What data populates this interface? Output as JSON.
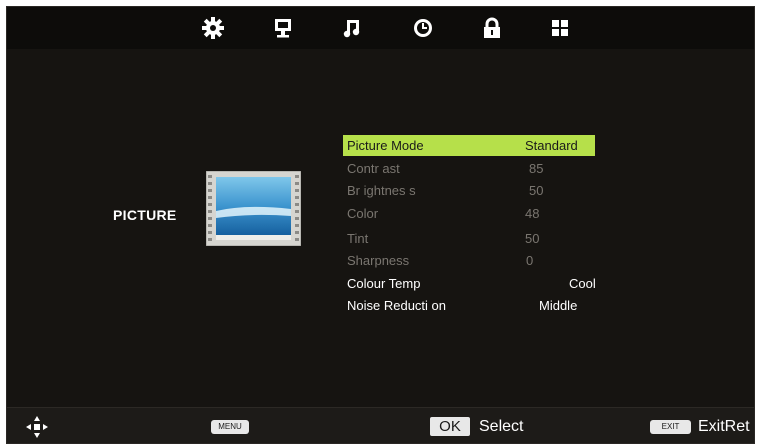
{
  "top_nav": [
    {
      "id": "picture",
      "icon": "gear-icon"
    },
    {
      "id": "screen",
      "icon": "monitor-icon"
    },
    {
      "id": "sound",
      "icon": "music-note-icon"
    },
    {
      "id": "time",
      "icon": "clock-icon"
    },
    {
      "id": "lock",
      "icon": "lock-icon"
    },
    {
      "id": "setup",
      "icon": "grid-icon"
    }
  ],
  "section_label": "PICTURE",
  "menu": [
    {
      "label": "Picture Mode",
      "value": "Standard",
      "state": "selected"
    },
    {
      "label": "Contr ast",
      "value": "85",
      "state": "disabled"
    },
    {
      "label": "Br ightnes s",
      "value": "50",
      "state": "disabled"
    },
    {
      "label": "Color",
      "value": "48",
      "state": "disabled"
    },
    {
      "label": "Tint",
      "value": "50",
      "state": "disabled"
    },
    {
      "label": "Sharpness",
      "value": "0",
      "state": "disabled"
    },
    {
      "label": "Colour Temp",
      "value": "Cool",
      "state": "enabled"
    },
    {
      "label": "Noise Reducti on",
      "value": "Middle",
      "state": "enabled"
    }
  ],
  "bottom": {
    "menu_key": "MENU",
    "ok_key": "OK",
    "select_label": "Select",
    "exit_key": "EXIT",
    "exit_label": "ExitRet"
  },
  "colors": {
    "highlight": "#b6e04a",
    "background": "#161411",
    "text": "#ffffff",
    "disabled_text": "#7a7670"
  }
}
